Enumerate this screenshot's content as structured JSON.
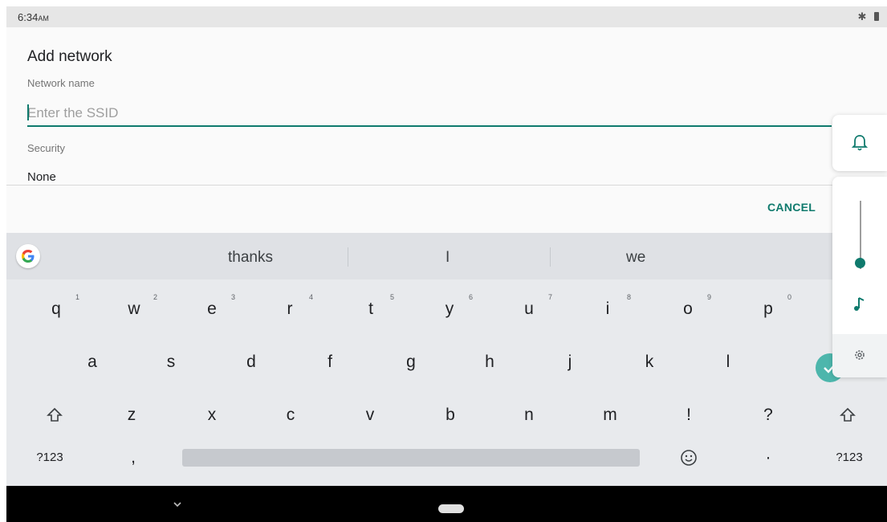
{
  "status_bar": {
    "time": "6:34",
    "ampm": "AM"
  },
  "dialog": {
    "title": "Add network",
    "network_name_label": "Network name",
    "ssid_placeholder": "Enter the SSID",
    "ssid_value": "",
    "security_label": "Security",
    "security_value": "None",
    "cancel_label": "CANCEL"
  },
  "keyboard": {
    "suggestions": [
      "thanks",
      "I",
      "we"
    ],
    "row1": [
      {
        "key": "q",
        "hint": "1"
      },
      {
        "key": "w",
        "hint": "2"
      },
      {
        "key": "e",
        "hint": "3"
      },
      {
        "key": "r",
        "hint": "4"
      },
      {
        "key": "t",
        "hint": "5"
      },
      {
        "key": "y",
        "hint": "6"
      },
      {
        "key": "u",
        "hint": "7"
      },
      {
        "key": "i",
        "hint": "8"
      },
      {
        "key": "o",
        "hint": "9"
      },
      {
        "key": "p",
        "hint": "0"
      }
    ],
    "row2": [
      "a",
      "s",
      "d",
      "f",
      "g",
      "h",
      "j",
      "k",
      "l"
    ],
    "row3": [
      "z",
      "x",
      "c",
      "v",
      "b",
      "n",
      "m",
      "!",
      "?"
    ],
    "symbols_label": "?123",
    "comma": ",",
    "period": "·"
  },
  "volume_panel": {
    "level": 0.1
  },
  "colors": {
    "accent": "#0f7a6d",
    "enter_key": "#4db6ac",
    "keyboard_bg": "#e8eaed"
  }
}
